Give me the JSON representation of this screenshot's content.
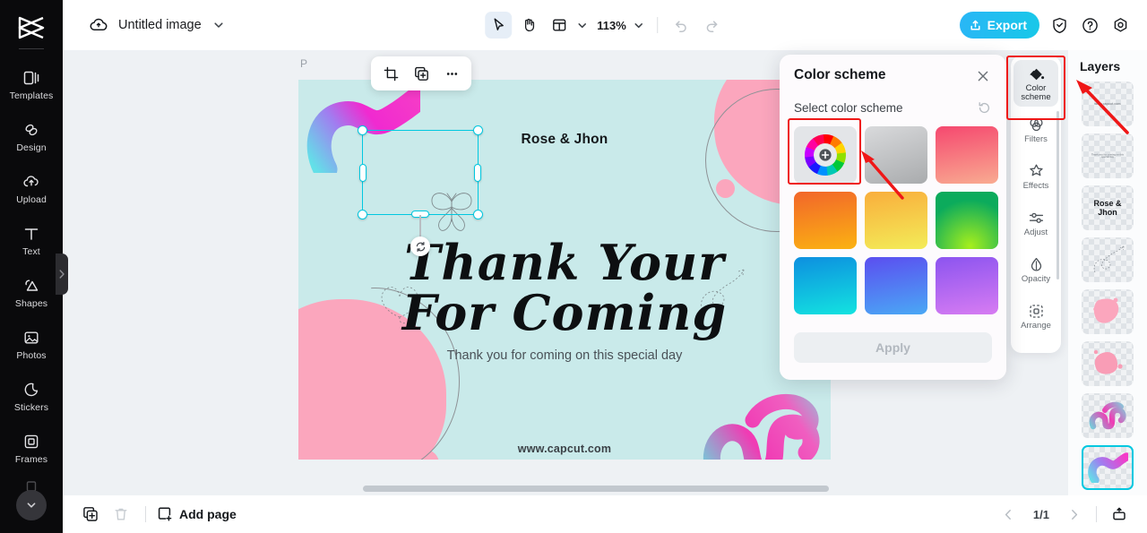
{
  "app": {
    "brand_icon": "capcut-logo-icon",
    "doc_title": "Untitled image"
  },
  "left_rail": {
    "items": [
      {
        "label": "Templates",
        "icon": "templates-icon"
      },
      {
        "label": "Design",
        "icon": "design-icon"
      },
      {
        "label": "Upload",
        "icon": "upload-cloud-icon"
      },
      {
        "label": "Text",
        "icon": "text-icon"
      },
      {
        "label": "Shapes",
        "icon": "shapes-icon"
      },
      {
        "label": "Photos",
        "icon": "photos-icon"
      },
      {
        "label": "Stickers",
        "icon": "stickers-icon"
      },
      {
        "label": "Frames",
        "icon": "frames-icon"
      }
    ],
    "collapse_icon": "chevron-right-icon",
    "more_icon": "chevron-down-icon"
  },
  "topbar": {
    "cloud_icon": "cloud-save-icon",
    "title_chevron_icon": "chevron-down-icon",
    "select_tool_icon": "cursor-arrow-icon",
    "hand_tool_icon": "hand-icon",
    "layout_tool_icon": "layout-grid-icon",
    "layout_chevron_icon": "chevron-down-icon",
    "zoom_level": "113%",
    "zoom_chevron_icon": "chevron-down-icon",
    "undo_icon": "undo-icon",
    "redo_icon": "redo-icon",
    "export_label": "Export",
    "export_icon": "upload-share-icon",
    "shield_icon": "shield-check-icon",
    "help_icon": "question-circle-icon",
    "settings_icon": "gear-icon",
    "export_color": "#1ec3e6"
  },
  "canvas": {
    "page_letter": "P",
    "background_color": "#c9eaea",
    "accent_pink": "#fba6bd",
    "names_text": "Rose & Jhon",
    "script_line_1": "Thank Your",
    "script_line_2": "For Coming",
    "subtitle_text": "Thank you for coming on this special day",
    "website_text": "www.capcut.com",
    "selection": {
      "crop_icon": "crop-icon",
      "duplicate_icon": "duplicate-icon",
      "more_icon": "more-horizontal-icon",
      "rotate_icon": "rotate-icon",
      "handle_color": "#00c8e0"
    }
  },
  "color_scheme_panel": {
    "title": "Color scheme",
    "close_icon": "close-icon",
    "subtitle": "Select color scheme",
    "reset_icon": "reset-icon",
    "apply_label": "Apply",
    "apply_disabled": true,
    "swatches": [
      {
        "name": "custom-color-wheel",
        "type": "wheel",
        "from": "",
        "to": ""
      },
      {
        "name": "gray-gradient",
        "type": "gradient",
        "from": "#d7d8da",
        "to": "#a9abad"
      },
      {
        "name": "pink-gradient",
        "type": "gradient",
        "from": "#f5486f",
        "to": "#f9ab91"
      },
      {
        "name": "orange-gradient",
        "type": "gradient",
        "from": "#f2662a",
        "to": "#fbb212"
      },
      {
        "name": "yellow-gradient",
        "type": "gradient",
        "from": "#f9ae3c",
        "to": "#f3ec58"
      },
      {
        "name": "green-gradient",
        "type": "gradient",
        "from": "#0cab5c",
        "to": "#9ae81c"
      },
      {
        "name": "cyan-gradient",
        "type": "gradient",
        "from": "#0d8fe0",
        "to": "#13e3e0"
      },
      {
        "name": "blue-gradient",
        "type": "gradient",
        "from": "#5b4ef0",
        "to": "#4aa8f5"
      },
      {
        "name": "purple-gradient",
        "type": "gradient",
        "from": "#8c54f0",
        "to": "#d77cf2"
      }
    ]
  },
  "right_rail": {
    "items": [
      {
        "label": "Color scheme",
        "icon": "paint-bucket-icon",
        "active": true
      },
      {
        "label": "Filters",
        "icon": "filters-icon",
        "active": false
      },
      {
        "label": "Effects",
        "icon": "effects-sparkle-icon",
        "active": false
      },
      {
        "label": "Adjust",
        "icon": "sliders-icon",
        "active": false
      },
      {
        "label": "Opacity",
        "icon": "droplet-icon",
        "active": false
      },
      {
        "label": "Arrange",
        "icon": "arrange-icon",
        "active": false
      }
    ]
  },
  "layers_panel": {
    "title": "Layers",
    "items": [
      {
        "name": "layer-website",
        "preview": "www.capcut.com",
        "style": "tiny",
        "selected": false
      },
      {
        "name": "layer-subtitle",
        "preview": "Thank you for coming on this special day",
        "style": "tiny",
        "selected": false
      },
      {
        "name": "layer-names",
        "preview": "Rose & Jhon",
        "style": "big",
        "selected": false
      },
      {
        "name": "layer-doodle",
        "preview": "",
        "style": "doodle",
        "selected": false
      },
      {
        "name": "layer-pink-shape-1",
        "preview": "",
        "style": "pink1",
        "selected": false
      },
      {
        "name": "layer-pink-shape-2",
        "preview": "",
        "style": "pink2",
        "selected": false
      },
      {
        "name": "layer-swirl-knot",
        "preview": "",
        "style": "swirl",
        "selected": false
      },
      {
        "name": "layer-swirl-wave",
        "preview": "",
        "style": "wave",
        "selected": true
      }
    ]
  },
  "bottombar": {
    "duplicate_icon": "duplicate-page-icon",
    "delete_icon": "trash-icon",
    "add_page_label": "Add page",
    "add_page_icon": "add-page-icon",
    "prev_icon": "chevron-left-icon",
    "next_icon": "chevron-right-icon",
    "page_indicator": "1/1",
    "present_icon": "present-icon"
  },
  "annotations": {
    "highlight_color": "#ef1717",
    "boxes": [
      "color-wheel-swatch",
      "color-scheme-rail-item"
    ],
    "arrows": [
      "arrow-to-gray-swatch",
      "arrow-to-top-layer"
    ]
  }
}
